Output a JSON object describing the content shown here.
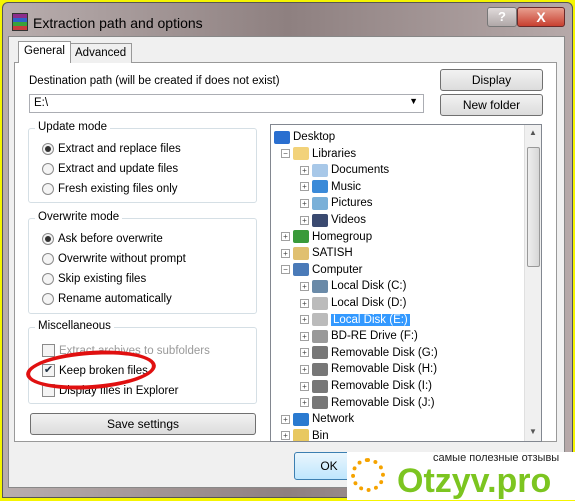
{
  "window": {
    "title": "Extraction path and options",
    "help_label": "?",
    "close_label": "X"
  },
  "tabs": [
    {
      "label": "General",
      "active": true
    },
    {
      "label": "Advanced",
      "active": false
    }
  ],
  "destination": {
    "label": "Destination path (will be created if does not exist)",
    "value": "E:\\"
  },
  "buttons": {
    "display": "Display",
    "new_folder": "New folder",
    "save_settings": "Save settings",
    "ok": "OK"
  },
  "update_mode": {
    "title": "Update mode",
    "options": [
      {
        "label": "Extract and replace files",
        "selected": true
      },
      {
        "label": "Extract and update files",
        "selected": false
      },
      {
        "label": "Fresh existing files only",
        "selected": false
      }
    ]
  },
  "overwrite_mode": {
    "title": "Overwrite mode",
    "options": [
      {
        "label": "Ask before overwrite",
        "selected": true
      },
      {
        "label": "Overwrite without prompt",
        "selected": false
      },
      {
        "label": "Skip existing files",
        "selected": false
      },
      {
        "label": "Rename automatically",
        "selected": false
      }
    ]
  },
  "misc": {
    "title": "Miscellaneous",
    "options": [
      {
        "label": "Extract archives to subfolders",
        "checked": false,
        "disabled": true
      },
      {
        "label": "Keep broken files",
        "checked": true,
        "disabled": false
      },
      {
        "label": "Display files in Explorer",
        "checked": false,
        "disabled": false
      }
    ]
  },
  "tree": [
    {
      "label": "Desktop",
      "icon": "desktop-icon",
      "level": 0
    },
    {
      "label": "Libraries",
      "icon": "library-icon",
      "level": 1,
      "expanded": true
    },
    {
      "label": "Documents",
      "icon": "documents-icon",
      "level": 2
    },
    {
      "label": "Music",
      "icon": "music-icon",
      "level": 2
    },
    {
      "label": "Pictures",
      "icon": "pictures-icon",
      "level": 2
    },
    {
      "label": "Videos",
      "icon": "videos-icon",
      "level": 2
    },
    {
      "label": "Homegroup",
      "icon": "homegroup-icon",
      "level": 1
    },
    {
      "label": "SATISH",
      "icon": "user-folder-icon",
      "level": 1
    },
    {
      "label": "Computer",
      "icon": "computer-icon",
      "level": 1,
      "expanded": true
    },
    {
      "label": "Local Disk (C:)",
      "icon": "system-disk-icon",
      "level": 2
    },
    {
      "label": "Local Disk (D:)",
      "icon": "disk-icon",
      "level": 2
    },
    {
      "label": "Local Disk (E:)",
      "icon": "disk-icon",
      "level": 2,
      "selected": true
    },
    {
      "label": "BD-RE Drive (F:)",
      "icon": "optical-drive-icon",
      "level": 2
    },
    {
      "label": "Removable Disk (G:)",
      "icon": "removable-disk-icon",
      "level": 2
    },
    {
      "label": "Removable Disk (H:)",
      "icon": "removable-disk-icon",
      "level": 2
    },
    {
      "label": "Removable Disk (I:)",
      "icon": "removable-disk-icon",
      "level": 2
    },
    {
      "label": "Removable Disk (J:)",
      "icon": "removable-disk-icon",
      "level": 2
    },
    {
      "label": "Network",
      "icon": "network-icon",
      "level": 1
    },
    {
      "label": "Bin",
      "icon": "folder-icon",
      "level": 1
    }
  ],
  "watermark": {
    "tagline": "самые полезные отзывы",
    "brand": "Otzyv.pro"
  },
  "colors": {
    "selection": "#3399ff",
    "annotation": "#e01010",
    "brand_green": "#7cc520",
    "brand_orange": "#f5a300"
  }
}
